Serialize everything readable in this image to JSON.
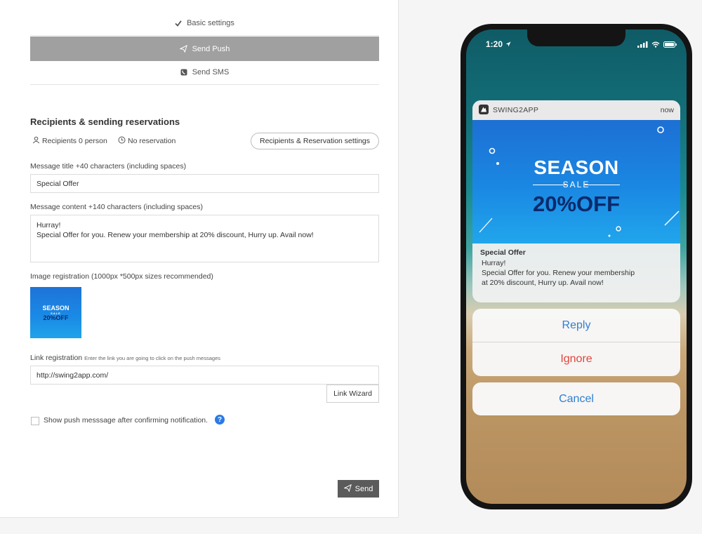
{
  "tabs": [
    {
      "label": "Basic settings",
      "icon": "check-icon"
    },
    {
      "label": "Send Push",
      "icon": "paper-plane-icon",
      "active": true
    },
    {
      "label": "Send SMS",
      "icon": "phone-icon"
    }
  ],
  "recipients": {
    "title": "Recipients & sending reservations",
    "recipients_text": "Recipients 0 person",
    "reservation_text": "No reservation",
    "settings_button": "Recipients & Reservation settings"
  },
  "message": {
    "title_label": "Message title +40 characters (including spaces)",
    "title_value": "Special Offer",
    "content_label": "Message content +140 characters (including spaces)",
    "content_line1": "Hurray!",
    "content_line2": "Special Offer for you. Renew your membership at 20% discount, Hurry up. Avail now!"
  },
  "image": {
    "label": "Image registration (1000px *500px sizes recommended)",
    "thumb_line1": "SEASON",
    "thumb_line2": "SALE",
    "thumb_line3": "20%OFF"
  },
  "link": {
    "label": "Link registration",
    "hint": "Enter the link you are going to click on the push messages",
    "value": "http://swing2app.com/",
    "wizard_button": "Link Wizard"
  },
  "option": {
    "checkbox_label": "Show push messsage after confirming notification.",
    "help": "?"
  },
  "send_button": "Send",
  "phone": {
    "time": "1:20",
    "notification": {
      "app_name": "SWING2APP",
      "time": "now",
      "banner_line1": "SEASON",
      "banner_line2": "SALE",
      "banner_line3": "20%OFF",
      "title": "Special Offer",
      "line1": "Hurray!",
      "line2": "Special Offer for you. Renew your membership",
      "line3": "at 20% discount, Hurry up. Avail now!"
    },
    "actions": {
      "reply": "Reply",
      "ignore": "Ignore",
      "cancel": "Cancel"
    }
  },
  "colors": {
    "active_tab": "#a0a0a0",
    "send_button": "#5b5b5b",
    "help_icon": "#2c7be5",
    "ios_blue": "#2f7fd0",
    "ios_red": "#e0453c"
  }
}
